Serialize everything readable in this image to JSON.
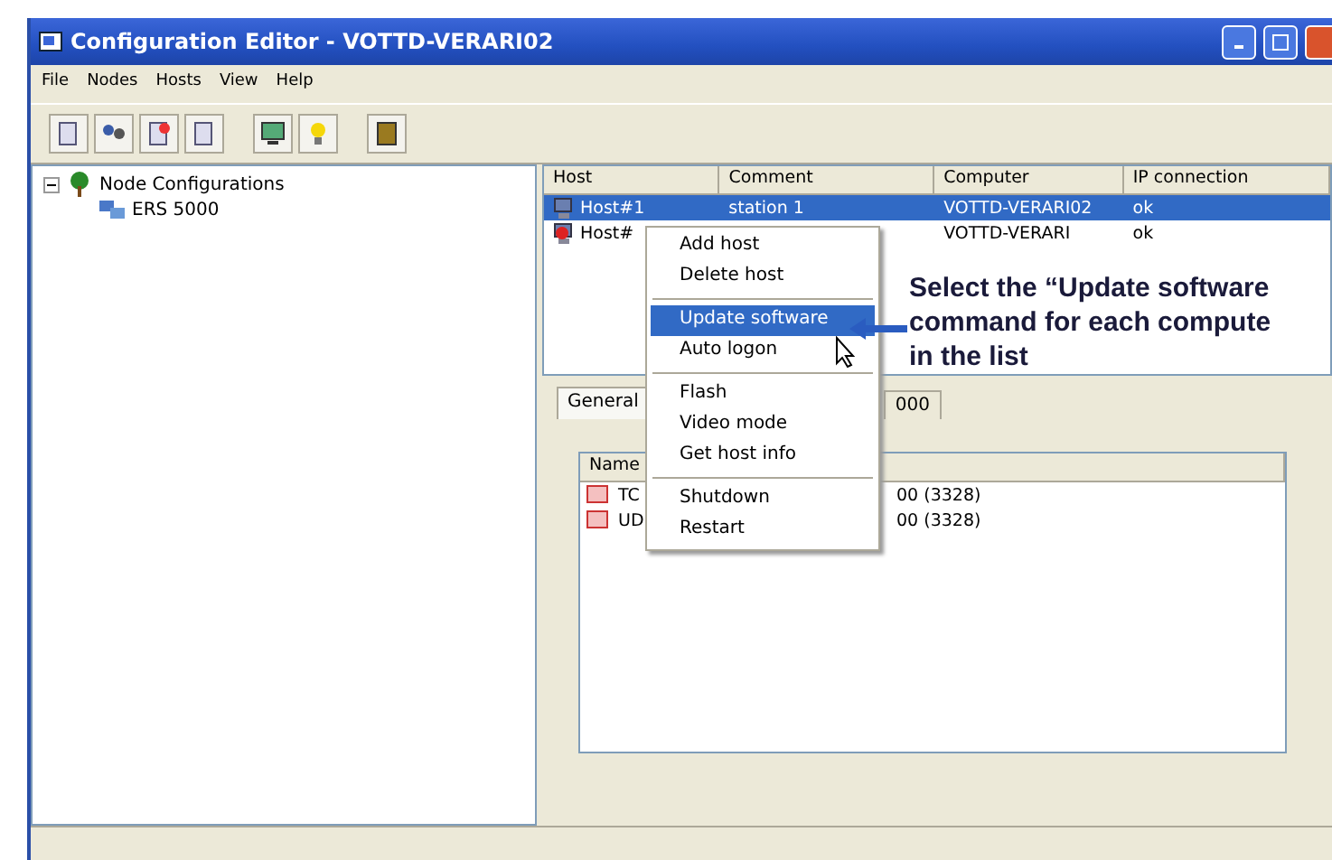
{
  "window": {
    "title": "Configuration Editor - VOTTD-VERARI02"
  },
  "menu_bar": [
    "File",
    "Nodes",
    "Hosts",
    "View",
    "Help"
  ],
  "tree": [
    {
      "label": "Node Configurations",
      "expanded": true,
      "children": [
        {
          "label": "ERS 5000"
        }
      ]
    }
  ],
  "hosts_table": {
    "columns": [
      "Host",
      "Comment",
      "Computer",
      "IP connection"
    ],
    "rows": [
      {
        "cells": [
          "Host#1",
          "station 1",
          "VOTTD-VERARI02",
          "ok"
        ],
        "selected": true
      },
      {
        "cells": [
          "Host#",
          "",
          "VOTTD-VERARI",
          "ok"
        ],
        "selected": false
      }
    ]
  },
  "tabs": [
    {
      "label": "General",
      "selected": true
    },
    {
      "label": "000",
      "selected": false
    }
  ],
  "detail_list": {
    "columns": [
      "Name"
    ],
    "rows": [
      [
        "TC",
        "00 (3328)"
      ],
      [
        "UD",
        "00 (3328)"
      ]
    ]
  },
  "context_menu": [
    {
      "kind": "item",
      "label": "Add host",
      "selected": false
    },
    {
      "kind": "item",
      "label": "Delete host",
      "selected": false
    },
    {
      "kind": "separator"
    },
    {
      "kind": "item",
      "label": "Update software",
      "selected": true
    },
    {
      "kind": "item",
      "label": "Auto logon",
      "selected": false
    },
    {
      "kind": "separator"
    },
    {
      "kind": "item",
      "label": "Flash",
      "selected": false
    },
    {
      "kind": "item",
      "label": "Video mode",
      "selected": false
    },
    {
      "kind": "item",
      "label": "Get host info",
      "selected": false
    },
    {
      "kind": "separator"
    },
    {
      "kind": "item",
      "label": "Shutdown",
      "selected": false
    },
    {
      "kind": "item",
      "label": "Restart",
      "selected": false
    }
  ],
  "annotation": [
    "Select the “Update software",
    "command for each compute",
    "in the list"
  ]
}
